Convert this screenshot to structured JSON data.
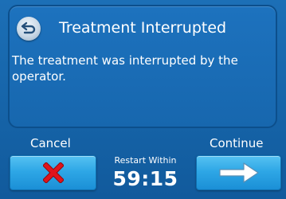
{
  "dialog": {
    "title": "Treatment Interrupted",
    "message": "The treatment was interrupted by the operator."
  },
  "buttons": {
    "cancel_label": "Cancel",
    "continue_label": "Continue"
  },
  "restart": {
    "label": "Restart Within",
    "countdown": "59:15"
  },
  "icons": {
    "back": "back-arrow-icon",
    "cancel": "red-x-icon",
    "continue": "right-arrow-icon"
  },
  "colors": {
    "background": "#1766ab",
    "button": "#2ea7e6",
    "cancel_x": "#e0141b",
    "text": "#ffffff"
  }
}
